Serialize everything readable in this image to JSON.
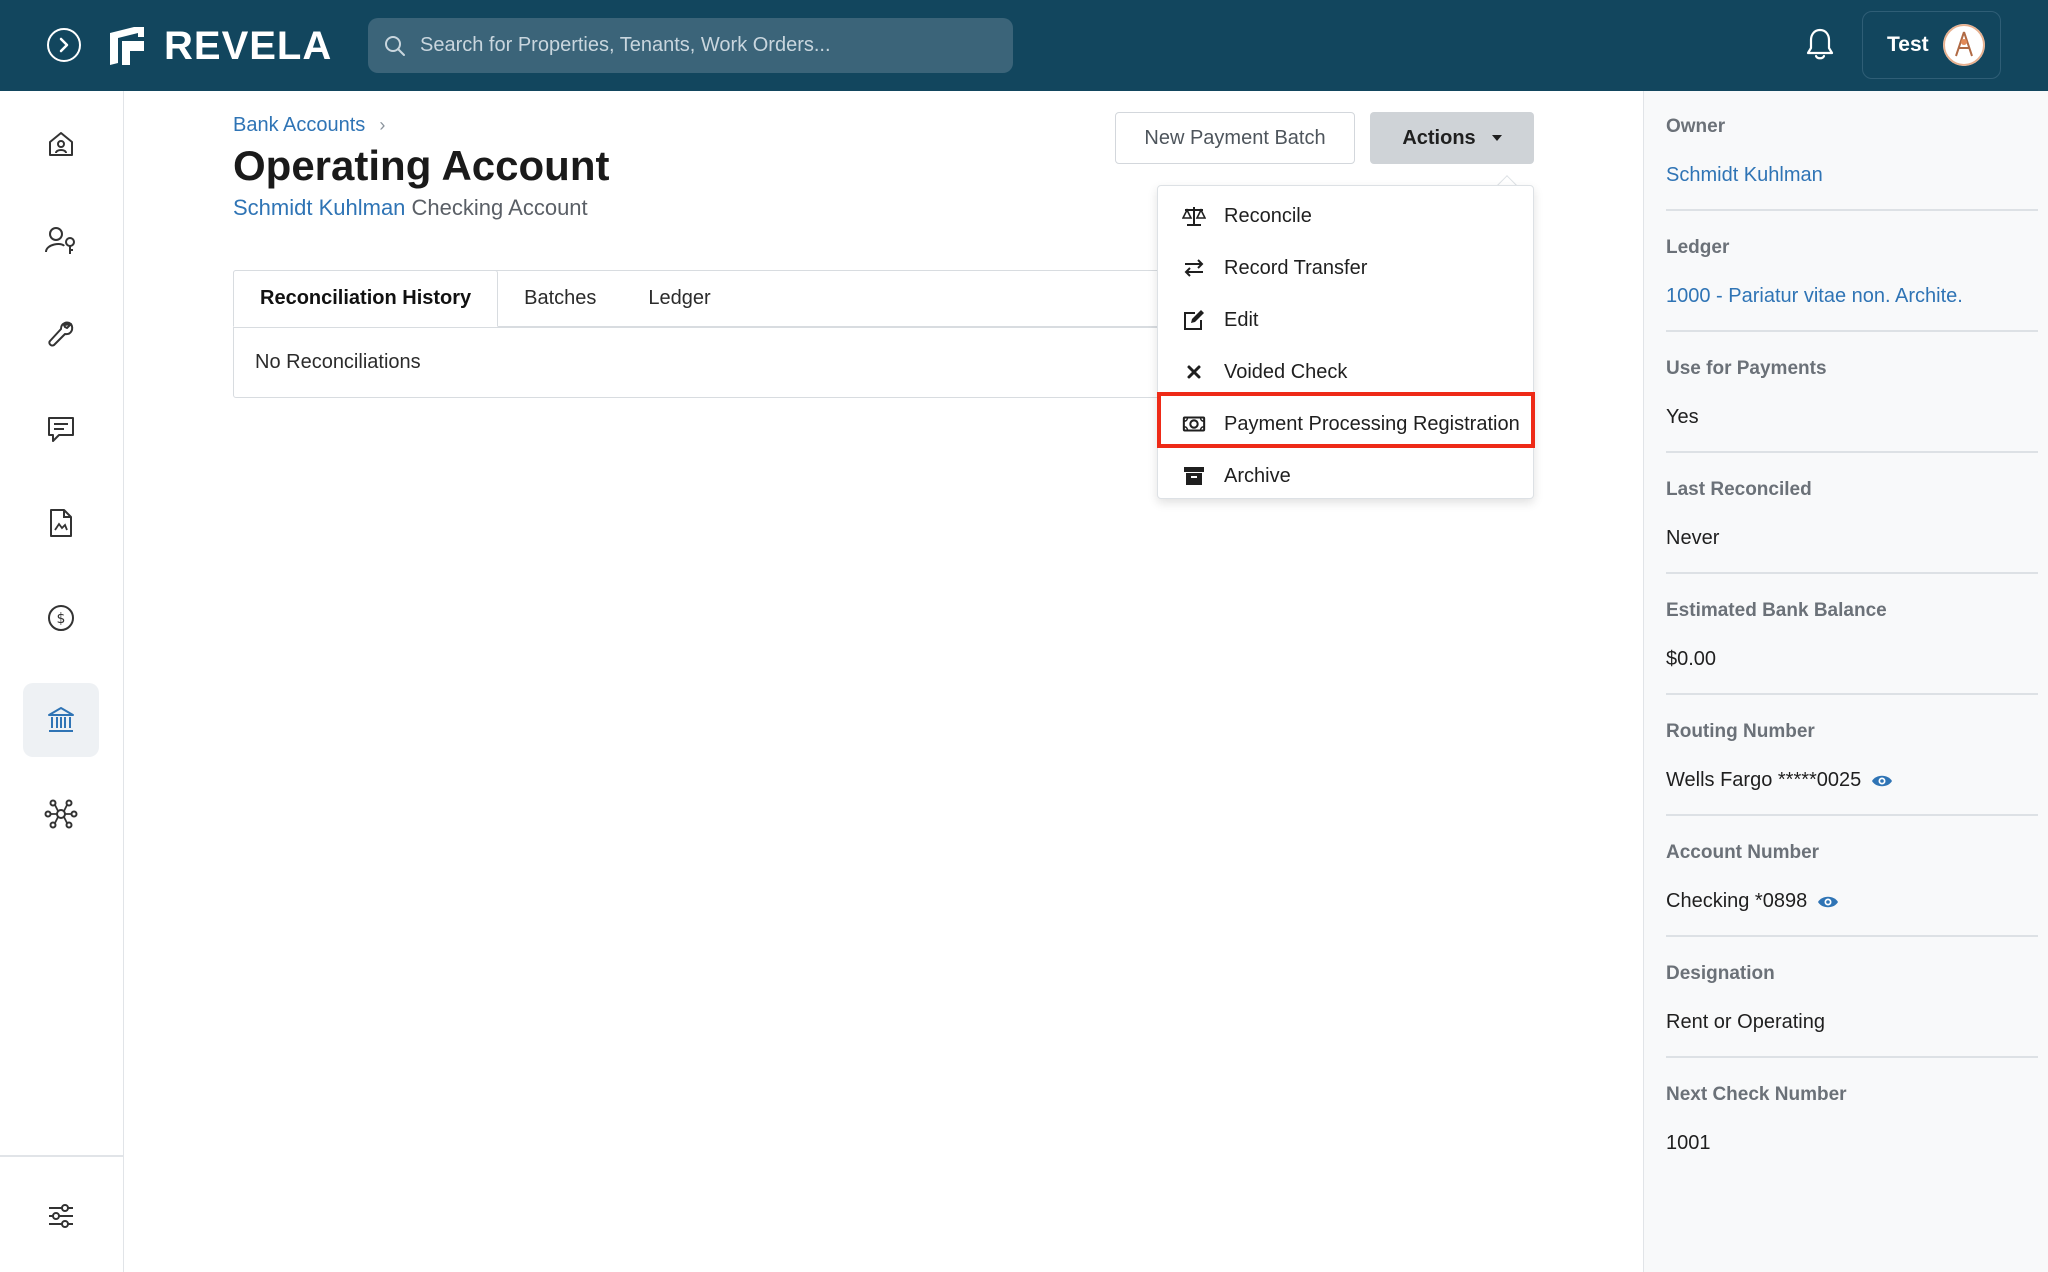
{
  "app": {
    "brand": "REVELA"
  },
  "search": {
    "placeholder": "Search for Properties, Tenants, Work Orders..."
  },
  "user": {
    "name": "Test"
  },
  "breadcrumb": {
    "parent": "Bank Accounts"
  },
  "page": {
    "title": "Operating Account",
    "owner_link": "Schmidt Kuhlman",
    "account_type": "Checking Account"
  },
  "buttons": {
    "new_payment_batch": "New Payment Batch",
    "actions": "Actions"
  },
  "tabs": [
    {
      "label": "Reconciliation History",
      "active": true
    },
    {
      "label": "Batches",
      "active": false
    },
    {
      "label": "Ledger",
      "active": false
    }
  ],
  "tab_content": {
    "empty_message": "No Reconciliations"
  },
  "actions_menu": {
    "items": [
      {
        "label": "Reconcile",
        "icon": "scale-icon"
      },
      {
        "label": "Record Transfer",
        "icon": "transfer-arrows-icon"
      },
      {
        "label": "Edit",
        "icon": "edit-icon"
      },
      {
        "label": "Voided Check",
        "icon": "x-icon"
      },
      {
        "label": "Payment Processing Registration",
        "icon": "money-bill-icon",
        "highlighted": true
      },
      {
        "label": "Archive",
        "icon": "archive-icon"
      }
    ]
  },
  "sidebar": {
    "items": [
      {
        "name": "home",
        "icon": "home-user-icon",
        "active": false
      },
      {
        "name": "tenants",
        "icon": "person-key-icon",
        "active": false
      },
      {
        "name": "maintenance",
        "icon": "wrench-icon",
        "active": false
      },
      {
        "name": "messages",
        "icon": "chat-icon",
        "active": false
      },
      {
        "name": "documents",
        "icon": "document-icon",
        "active": false
      },
      {
        "name": "payments",
        "icon": "dollar-circle-icon",
        "active": false
      },
      {
        "name": "banking",
        "icon": "bank-icon",
        "active": true
      },
      {
        "name": "integrations",
        "icon": "network-icon",
        "active": false
      }
    ],
    "bottom": {
      "icon": "sliders-icon"
    }
  },
  "details": {
    "owner": {
      "label": "Owner",
      "value": "Schmidt Kuhlman"
    },
    "ledger": {
      "label": "Ledger",
      "value": "1000 - Pariatur vitae non. Archite."
    },
    "use_for_payments": {
      "label": "Use for Payments",
      "value": "Yes"
    },
    "last_reconciled": {
      "label": "Last Reconciled",
      "value": "Never"
    },
    "estimated_balance": {
      "label": "Estimated Bank Balance",
      "value": "$0.00"
    },
    "routing_number": {
      "label": "Routing Number",
      "value": "Wells Fargo *****0025"
    },
    "account_number": {
      "label": "Account Number",
      "value": "Checking *0898"
    },
    "designation": {
      "label": "Designation",
      "value": "Rent or Operating"
    },
    "next_check_number": {
      "label": "Next Check Number",
      "value": "1001"
    }
  },
  "colors": {
    "topbar": "#12465e",
    "link": "#2f74b5",
    "highlight": "#ee2a17",
    "actions_button": "#cfd3d7"
  }
}
